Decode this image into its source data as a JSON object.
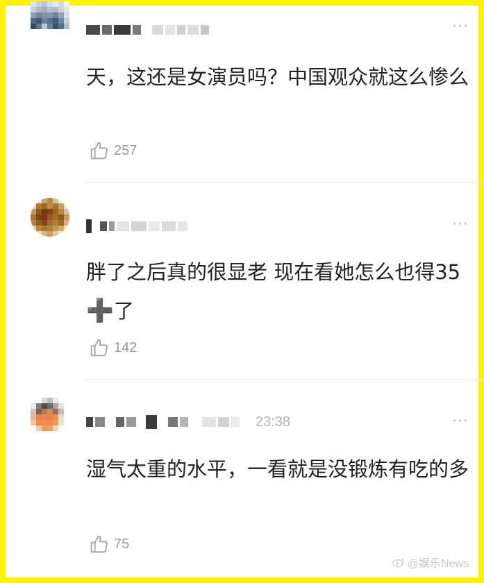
{
  "comments": [
    {
      "time": "",
      "text": "天，这还是女演员吗？中国观众就这么惨么",
      "likes": "257"
    },
    {
      "time": "",
      "text_before": "胖了之后真的很显老  现在看她怎么也得35",
      "emoji": "➕",
      "text_after": "了",
      "likes": "142"
    },
    {
      "time": "23:38",
      "text": "湿气太重的水平，一看就是没锻炼有吃的多",
      "likes": "75"
    }
  ],
  "more_label": "···",
  "watermark": "@娱乐News",
  "icons": {
    "like": "thumbs-up-icon",
    "more": "more-dots-icon",
    "weibo": "weibo-icon"
  },
  "colors": {
    "frame": "#FFF200",
    "text": "#222222",
    "meta": "#9a9a9a",
    "emoji": "#E8B230"
  }
}
